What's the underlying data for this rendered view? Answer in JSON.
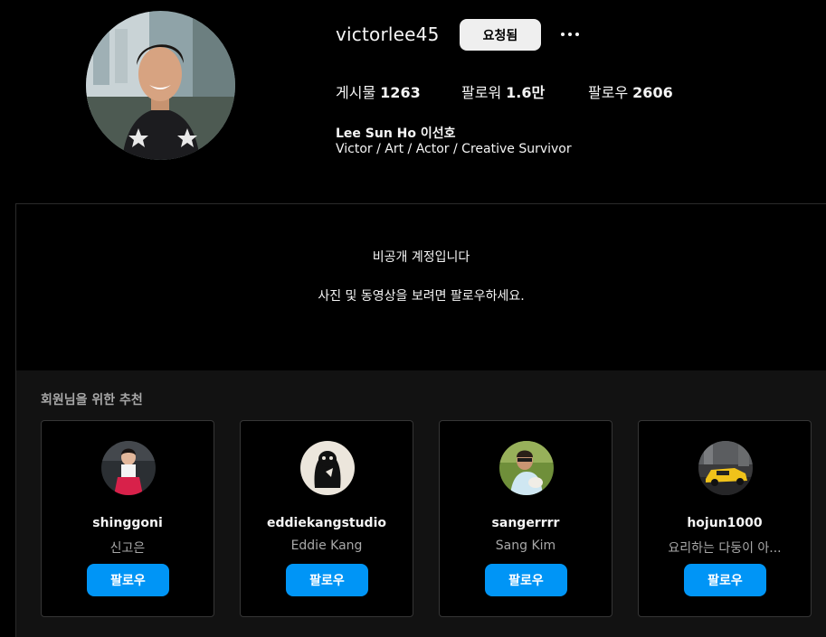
{
  "profile": {
    "username": "victorlee45",
    "requested_label": "요청됨",
    "more_icon": "ellipsis-icon",
    "stats": {
      "posts_label": "게시물",
      "posts_value": "1263",
      "followers_label": "팔로워",
      "followers_value": "1.6만",
      "following_label": "팔로우",
      "following_value": "2606"
    },
    "full_name": "Lee Sun Ho 이선호",
    "bio": "Victor / Art / Actor / Creative Survivor"
  },
  "private_notice": {
    "title": "비공개 계정입니다",
    "description": "사진 및 동영상을 보려면 팔로우하세요."
  },
  "suggestions": {
    "title": "회원님을 위한 추천",
    "follow_label": "팔로우",
    "cards": [
      {
        "handle": "shinggoni",
        "name": "신고은"
      },
      {
        "handle": "eddiekangstudio",
        "name": "Eddie Kang"
      },
      {
        "handle": "sangerrrr",
        "name": "Sang Kim"
      },
      {
        "handle": "hojun1000",
        "name": "요리하는 다둥이 아..."
      }
    ]
  },
  "colors": {
    "background": "#000000",
    "panel": "#121212",
    "button_primary": "#0095f6",
    "button_secondary": "#efefef",
    "muted_text": "#a8a8a8"
  }
}
